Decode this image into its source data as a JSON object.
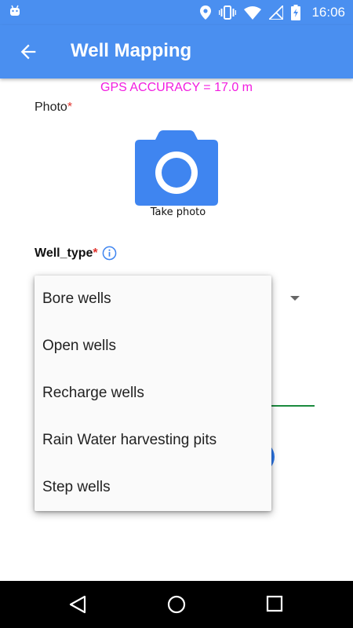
{
  "status_bar": {
    "time": "16:06",
    "icons": [
      "android-icon",
      "location-icon",
      "vibrate-icon",
      "wifi-icon",
      "no-signal-icon",
      "battery-charging-icon"
    ]
  },
  "app_bar": {
    "title": "Well Mapping",
    "back_icon": "arrow-back-icon"
  },
  "gps_accuracy": "GPS ACCURACY = 17.0 m",
  "photo_field": {
    "label": "Photo",
    "required_mark": "*",
    "camera_icon": "camera-icon",
    "take_photo_label": "Take photo"
  },
  "well_type_field": {
    "label": "Well_type",
    "required_mark": "*",
    "info_icon": "info-icon"
  },
  "dropdown_menu": {
    "options": [
      "Bore wells",
      "Open wells",
      "Recharge wells",
      "Rain Water harvesting pits",
      "Step wells"
    ]
  },
  "nav_bar": {
    "icons": [
      "back-triangle-icon",
      "home-circle-icon",
      "recents-square-icon"
    ]
  },
  "colors": {
    "primary": "#4a8ff0",
    "gps_text": "#f21ce0",
    "required": "#e0322c",
    "accent_green": "#1b8a3e"
  }
}
